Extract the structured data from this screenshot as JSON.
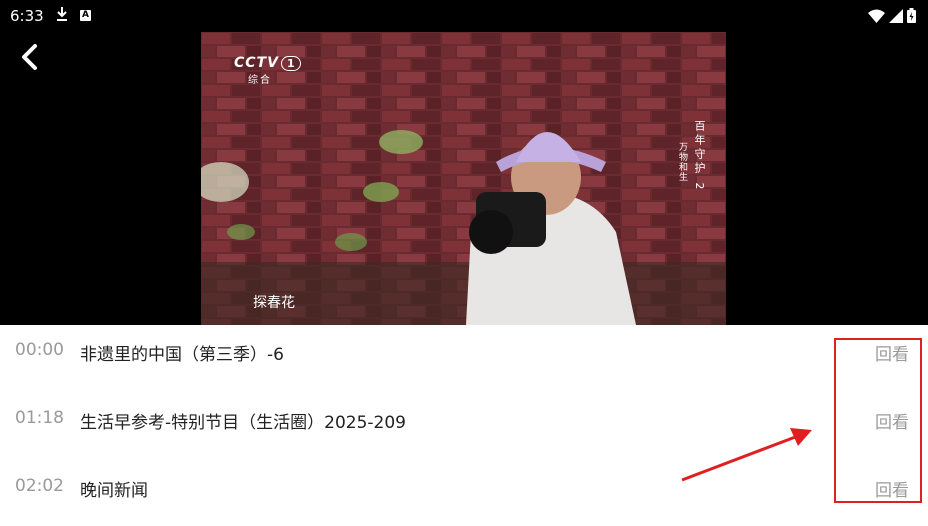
{
  "status_bar": {
    "time": "6:33",
    "icons": [
      "download-icon",
      "a-icon",
      "wifi-icon",
      "signal-icon",
      "battery-icon"
    ],
    "a_badge": "A"
  },
  "player": {
    "back_icon": "chevron-left-icon",
    "channel_logo_text": "CCTV",
    "channel_number": "1",
    "channel_sub": "综合",
    "subtitle": "探春花",
    "watermark_title": "百年守护",
    "watermark_sub": "万物和生",
    "watermark_number": "2"
  },
  "programs": [
    {
      "time": "00:00",
      "title": "非遗里的中国（第三季）-6",
      "action": "回看"
    },
    {
      "time": "01:18",
      "title": "生活早参考-特别节目（生活圈）2025-209",
      "action": "回看"
    },
    {
      "time": "02:02",
      "title": "晚间新闻",
      "action": "回看"
    }
  ],
  "colors": {
    "annotation_red": "#e02020",
    "muted_text": "#9a9a9a",
    "primary_text": "#222222"
  }
}
